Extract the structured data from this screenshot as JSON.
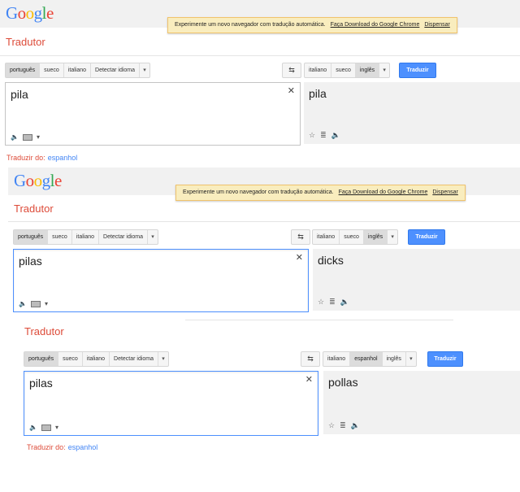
{
  "logo": {
    "letters": [
      "G",
      "o",
      "o",
      "g",
      "l",
      "e"
    ],
    "colors": [
      "#4285f4",
      "#ea4335",
      "#fbbc05",
      "#4285f4",
      "#34a853",
      "#ea4335"
    ]
  },
  "accent": {
    "title_red": "#dd4b39",
    "button_blue": "#4d90fe",
    "link_blue": "#4285f4"
  },
  "banner": {
    "text": "Experimente um novo navegador com tradução automática.",
    "download": "Faça Download do Google Chrome",
    "dismiss": "Dispensar"
  },
  "app_title": "Tradutor",
  "source_langs": [
    "português",
    "sueco",
    "italiano",
    "Detectar idioma"
  ],
  "swap_icon": "⇆",
  "translate_button": "Traduzir",
  "translate_from": {
    "label": "Traduzir do:",
    "lang": "espanhol"
  },
  "panels": [
    {
      "target_langs": [
        "italiano",
        "sueco",
        "inglês"
      ],
      "selected_target": 2,
      "input": "pila",
      "output": "pila"
    },
    {
      "target_langs": [
        "italiano",
        "sueco",
        "inglês"
      ],
      "selected_target": 2,
      "input": "pilas",
      "output": "dicks"
    },
    {
      "target_langs": [
        "italiano",
        "espanhol",
        "inglês"
      ],
      "selected_target": 1,
      "input": "pilas",
      "output": "pollas"
    }
  ]
}
